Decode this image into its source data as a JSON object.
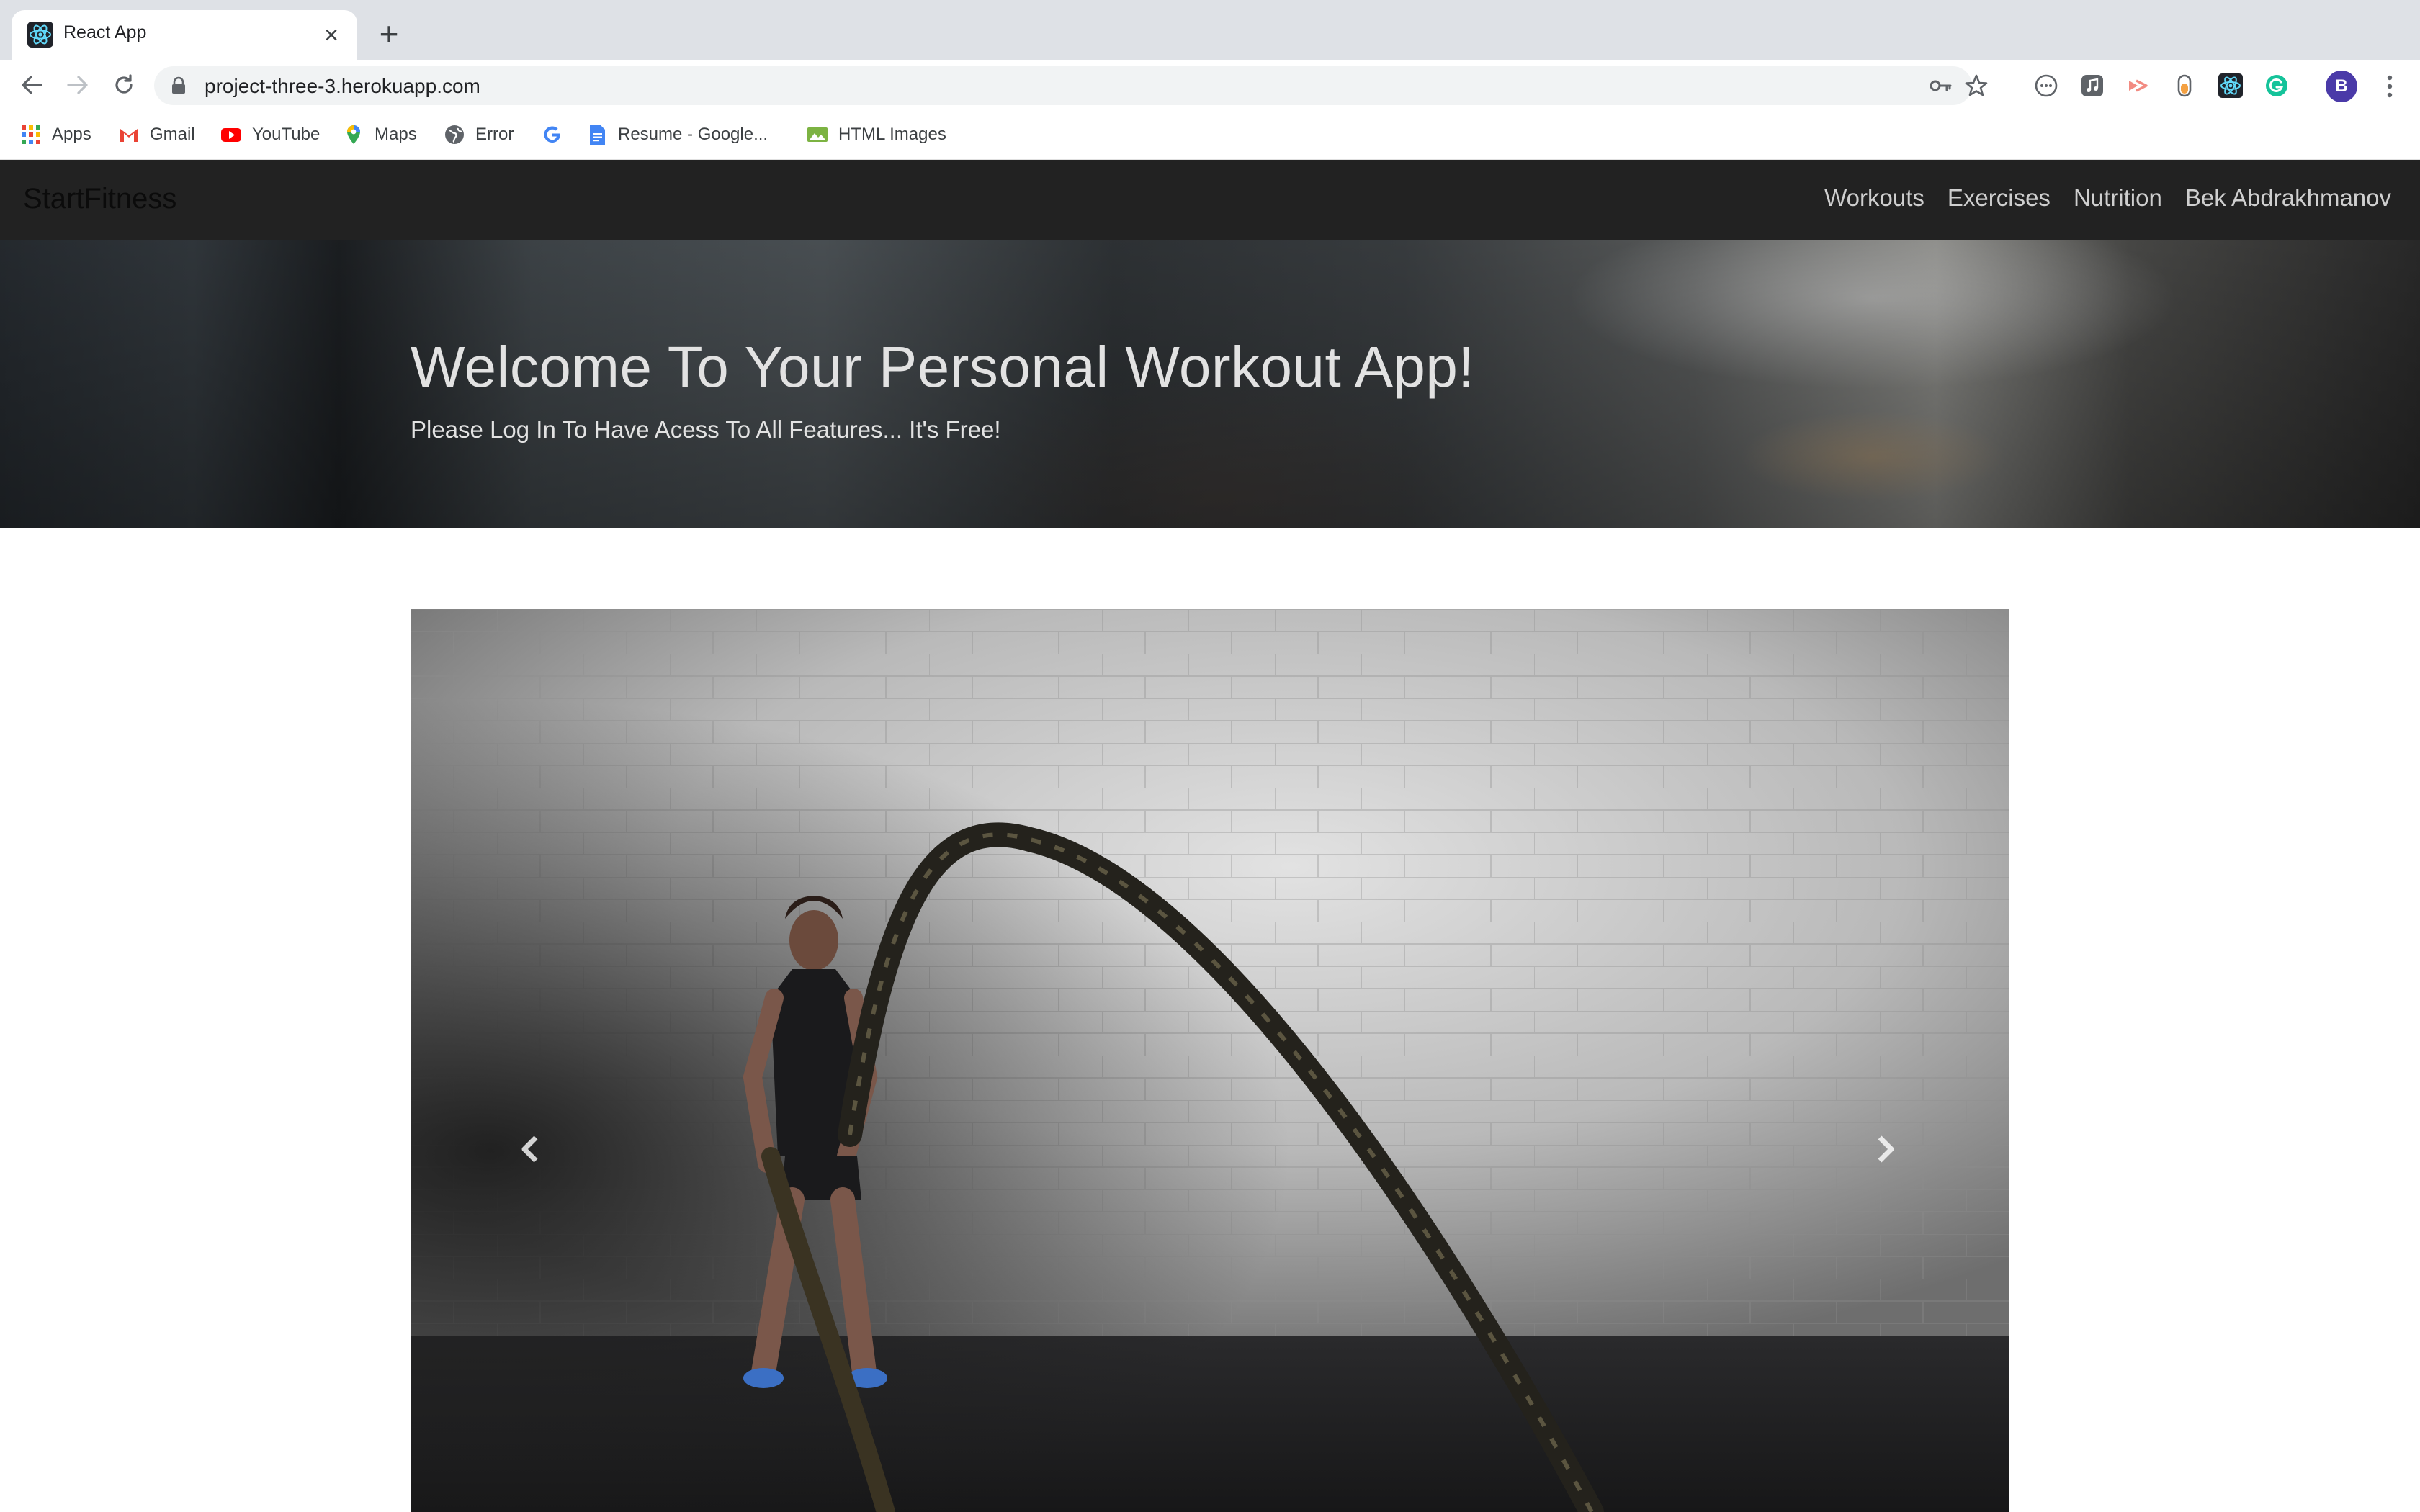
{
  "browser": {
    "tab": {
      "title": "React App",
      "favicon": "react-icon",
      "close_icon": "×"
    },
    "new_tab_icon": "+",
    "url": "project-three-3.herokuapp.com",
    "profile_initial": "B",
    "bookmarks": [
      {
        "label": "Apps",
        "icon": "apps-grid-icon"
      },
      {
        "label": "Gmail",
        "icon": "gmail-icon"
      },
      {
        "label": "YouTube",
        "icon": "youtube-icon"
      },
      {
        "label": "Maps",
        "icon": "maps-icon"
      },
      {
        "label": "Error",
        "icon": "globe-icon"
      },
      {
        "label": "",
        "icon": "google-icon"
      },
      {
        "label": "Resume - Google...",
        "icon": "docs-icon"
      },
      {
        "label": "HTML Images",
        "icon": "html-images-icon"
      }
    ]
  },
  "page": {
    "brand": "StartFitness",
    "nav": {
      "workouts": "Workouts",
      "exercises": "Exercises",
      "nutrition": "Nutrition",
      "user": "Bek Abdrakhmanov"
    },
    "hero": {
      "title": "Welcome To Your Personal Workout App!",
      "subtitle": "Please Log In To Have Acess To All Features... It's Free!"
    },
    "carousel": {
      "prev_icon": "chevron-left-icon",
      "next_icon": "chevron-right-icon"
    }
  }
}
